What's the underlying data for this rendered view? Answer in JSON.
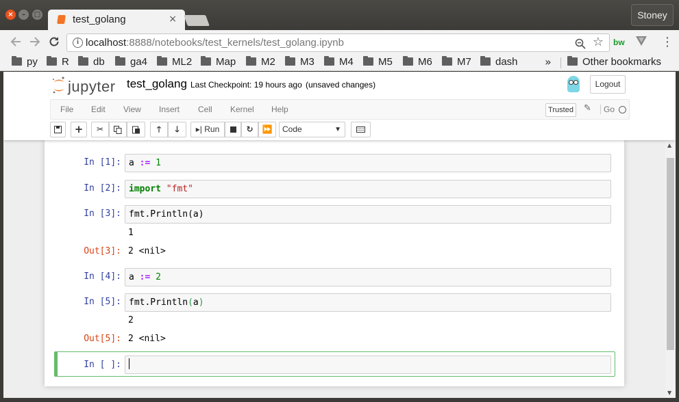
{
  "window": {
    "tab_title": "test_golang",
    "profile": "Stoney",
    "close_glyph": "×",
    "min_glyph": "–",
    "max_glyph": "□",
    "tab_close_glyph": "×"
  },
  "nav": {
    "url_host": "localhost",
    "url_path": ":8888/notebooks/test_kernels/test_golang.ipynb",
    "ext_label": "bw",
    "icons": [
      "back-icon",
      "forward-icon",
      "reload-icon",
      "info-icon",
      "zoom-icon",
      "star-icon",
      "menu-icon"
    ]
  },
  "bookmarks": {
    "items": [
      "py",
      "R",
      "db",
      "ga4",
      "ML2",
      "Map",
      "M2",
      "M3",
      "M4",
      "M5",
      "M6",
      "M7",
      "dash"
    ],
    "more": "»",
    "other": "Other bookmarks"
  },
  "jupyter": {
    "logo_text": "jupyter",
    "notebook_title": "test_golang",
    "checkpoint": "Last Checkpoint: 19 hours ago",
    "unsaved": "(unsaved changes)",
    "logout": "Logout",
    "menu": [
      "File",
      "Edit",
      "View",
      "Insert",
      "Cell",
      "Kernel",
      "Help"
    ],
    "trusted": "Trusted",
    "kernel_name": "Go",
    "run_label": "Run",
    "cell_type": "Code"
  },
  "cells": [
    {
      "prompt": "In [1]:",
      "code": [
        {
          "t": "a ",
          "c": ""
        },
        {
          "t": ":=",
          "c": "op"
        },
        {
          "t": " ",
          "c": ""
        },
        {
          "t": "1",
          "c": "num"
        }
      ]
    },
    {
      "prompt": "In [2]:",
      "code": [
        {
          "t": "import",
          "c": "kw"
        },
        {
          "t": " ",
          "c": ""
        },
        {
          "t": "\"fmt\"",
          "c": "str"
        }
      ]
    },
    {
      "prompt": "In [3]:",
      "code": [
        {
          "t": "fmt.Println(a)",
          "c": ""
        }
      ],
      "stdout": "1",
      "out_prompt": "Out[3]:",
      "out": "2 <nil>"
    },
    {
      "prompt": "In [4]:",
      "code": [
        {
          "t": "a ",
          "c": ""
        },
        {
          "t": ":=",
          "c": "op"
        },
        {
          "t": " ",
          "c": ""
        },
        {
          "t": "2",
          "c": "num"
        }
      ]
    },
    {
      "prompt": "In [5]:",
      "code": [
        {
          "t": "fmt.Println",
          "c": ""
        },
        {
          "t": "(",
          "c": "paren"
        },
        {
          "t": "a",
          "c": ""
        },
        {
          "t": ")",
          "c": "paren"
        }
      ],
      "stdout": "2",
      "out_prompt": "Out[5]:",
      "out": "2 <nil>"
    },
    {
      "prompt": "In [ ]:",
      "code": []
    }
  ]
}
